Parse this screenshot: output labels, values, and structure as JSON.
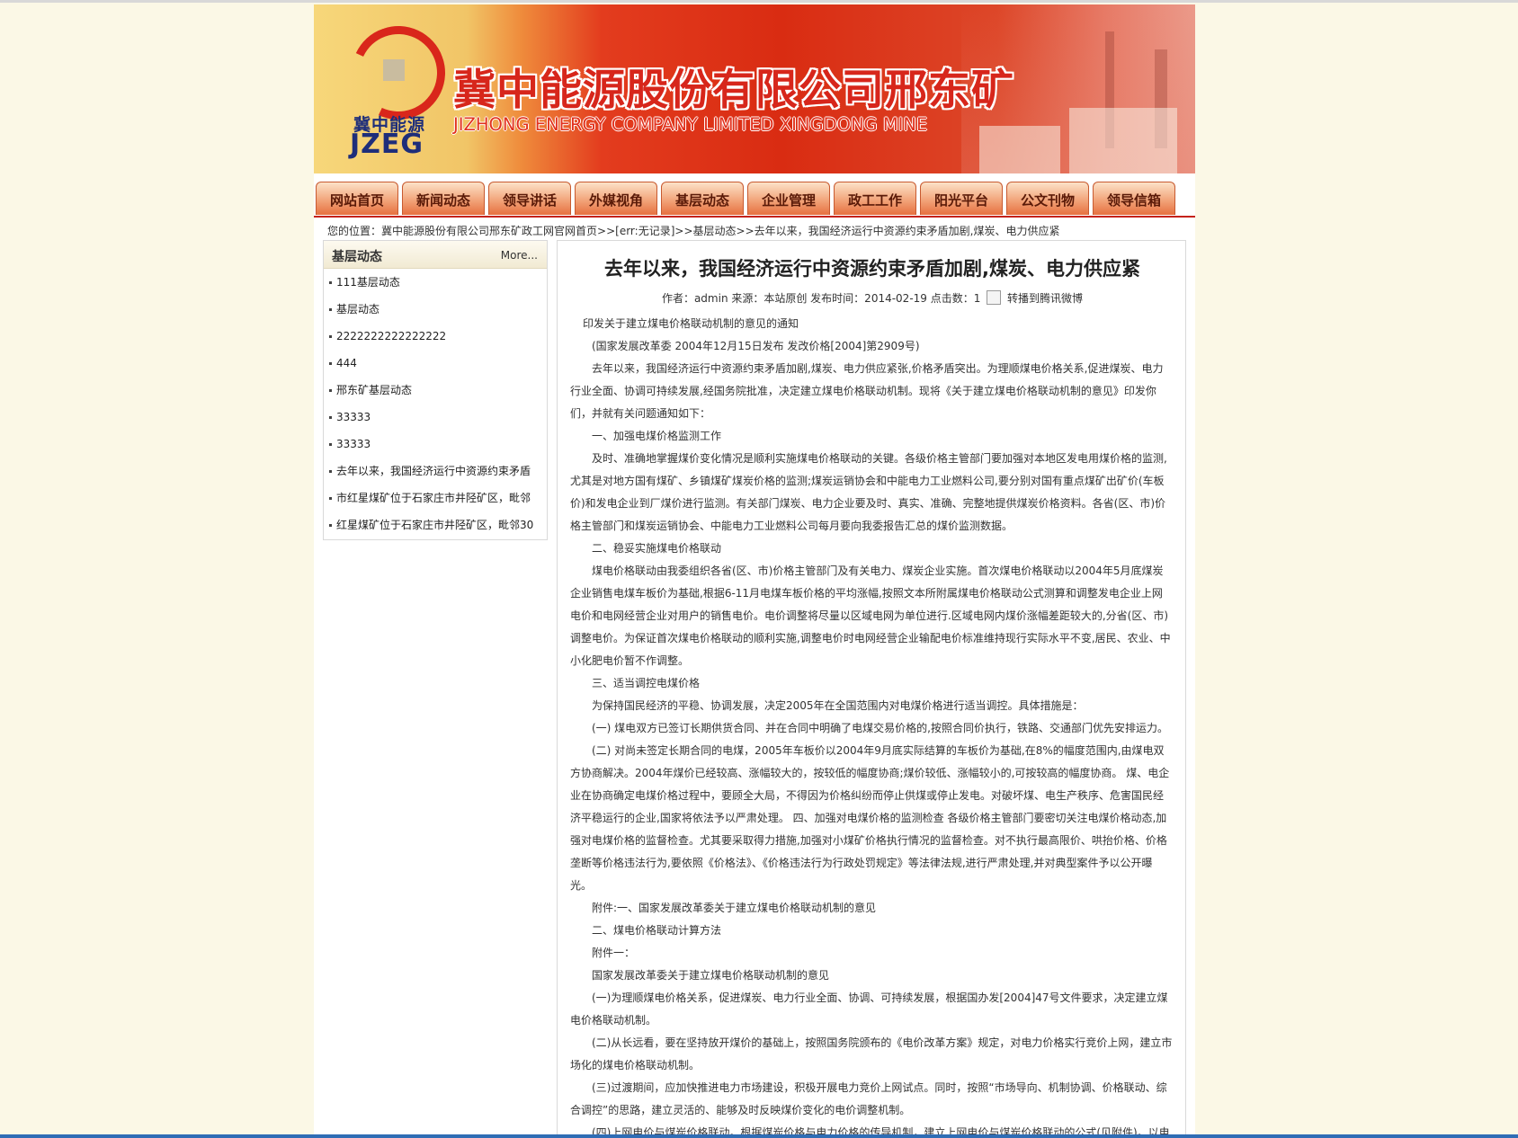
{
  "header": {
    "logo_cn": "冀中能源",
    "logo_en": "JZEG",
    "title_cn": "冀中能源股份有限公司邢东矿",
    "title_en": "JIZHONG ENERGY COMPANY LIMITED XINGDONG MINE"
  },
  "nav": {
    "items": [
      {
        "label": "网站首页"
      },
      {
        "label": "新闻动态"
      },
      {
        "label": "领导讲话"
      },
      {
        "label": "外媒视角"
      },
      {
        "label": "基层动态"
      },
      {
        "label": "企业管理"
      },
      {
        "label": "政工工作"
      },
      {
        "label": "阳光平台"
      },
      {
        "label": "公文刊物"
      },
      {
        "label": "领导信箱"
      }
    ]
  },
  "breadcrumb": {
    "prefix": "您的位置：",
    "home": "冀中能源股份有限公司邢东矿政工网官网首页",
    "sep1": ">>",
    "err": "[err:无记录]",
    "sep2": ">>",
    "category": "基层动态",
    "sep3": ">>",
    "current": "去年以来，我国经济运行中资源约束矛盾加剧,煤炭、电力供应紧"
  },
  "sidebar": {
    "title": "基层动态",
    "more": "More...",
    "items": [
      {
        "label": "111基层动态"
      },
      {
        "label": "基层动态"
      },
      {
        "label": "2222222222222222"
      },
      {
        "label": "444"
      },
      {
        "label": "邢东矿基层动态"
      },
      {
        "label": "33333"
      },
      {
        "label": "33333"
      },
      {
        "label": "去年以来，我国经济运行中资源约束矛盾"
      },
      {
        "label": "市红星煤矿位于石家庄市井陉矿区，毗邻"
      },
      {
        "label": "红星煤矿位于石家庄市井陉矿区，毗邻30"
      }
    ]
  },
  "article": {
    "title": "去年以来，我国经济运行中资源约束矛盾加剧,煤炭、电力供应紧",
    "meta_left": "作者：admin 来源：本站原创 发布时间：2014-02-19 点击数：1",
    "share": "转播到腾讯微博",
    "paragraphs": [
      {
        "text": "印发关于建立煤电价格联动机制的意见的通知",
        "cls": "note"
      },
      {
        "text": "(国家发展改革委 2004年12月15日发布 发改价格[2004]第2909号)"
      },
      {
        "text": "去年以来，我国经济运行中资源约束矛盾加剧,煤炭、电力供应紧张,价格矛盾突出。为理顺煤电价格关系,促进煤炭、电力行业全面、协调可持续发展,经国务院批准，决定建立煤电价格联动机制。现将《关于建立煤电价格联动机制的意见》印发你们，并就有关问题通知如下："
      },
      {
        "text": "一、加强电煤价格监测工作"
      },
      {
        "text": "及时、准确地掌握煤价变化情况是顺利实施煤电价格联动的关键。各级价格主管部门要加强对本地区发电用煤价格的监测,尤其是对地方国有煤矿、乡镇煤矿煤炭价格的监测;煤炭运销协会和中能电力工业燃料公司,要分别对国有重点煤矿出矿价(车板价)和发电企业到厂煤价进行监测。有关部门煤炭、电力企业要及时、真实、准确、完整地提供煤炭价格资料。各省(区、市)价格主管部门和煤炭运销协会、中能电力工业燃料公司每月要向我委报告汇总的煤价监测数据。"
      },
      {
        "text": "二、稳妥实施煤电价格联动"
      },
      {
        "text": "煤电价格联动由我委组织各省(区、市)价格主管部门及有关电力、煤炭企业实施。首次煤电价格联动以2004年5月底煤炭企业销售电煤车板价为基础,根据6-11月电煤车板价格的平均涨幅,按照文本所附属煤电价格联动公式测算和调整发电企业上网电价和电网经营企业对用户的销售电价。电价调整将尽量以区域电网为单位进行.区域电网内煤价涨幅差距较大的,分省(区、市)调整电价。为保证首次煤电价格联动的顺利实施,调整电价时电网经营企业输配电价标准维持现行实际水平不变,居民、农业、中小化肥电价暂不作调整。"
      },
      {
        "text": "三、适当调控电煤价格"
      },
      {
        "text": "为保持国民经济的平稳、协调发展，决定2005年在全国范围内对电煤价格进行适当调控。具体措施是："
      },
      {
        "text": "(一) 煤电双方已签订长期供货合同、并在合同中明确了电煤交易价格的,按照合同价执行，铁路、交通部门优先安排运力。"
      },
      {
        "text": "(二) 对尚未签定长期合同的电煤，2005年车板价以2004年9月底实际结算的车板价为基础,在8%的幅度范围内,由煤电双方协商解决。2004年煤价已经较高、涨幅较大的，按较低的幅度协商;煤价较低、涨幅较小的,可按较高的幅度协商。 煤、电企业在协商确定电煤价格过程中，要顾全大局，不得因为价格纠纷而停止供煤或停止发电。对破坏煤、电生产秩序、危害国民经济平稳运行的企业,国家将依法予以严肃处理。 四、加强对电煤价格的监测检查 各级价格主管部门要密切关注电煤价格动态,加强对电煤价格的监督检查。尤其要采取得力措施,加强对小煤矿价格执行情况的监督检查。对不执行最高限价、哄抬价格、价格垄断等价格违法行为,要依照《价格法》、《价格违法行为行政处罚规定》等法律法规,进行严肃处理,并对典型案件予以公开曝光。"
      },
      {
        "text": "附件:一、国家发展改革委关于建立煤电价格联动机制的意见"
      },
      {
        "text": "二、煤电价格联动计算方法"
      },
      {
        "text": "附件一："
      },
      {
        "text": "国家发展改革委关于建立煤电价格联动机制的意见"
      },
      {
        "text": "(一)为理顺煤电价格关系，促进煤炭、电力行业全面、协调、可持续发展，根据国办发[2004]47号文件要求，决定建立煤电价格联动机制。"
      },
      {
        "text": "(二)从长远看，要在坚持放开煤价的基础上，按照国务院颁布的《电价改革方案》规定，对电力价格实行竞价上网，建立市场化的煤电价格联动机制。"
      },
      {
        "text": "(三)过渡期间，应加快推进电力市场建设，积极开展电力竞价上网试点。同时，按照“市场导向、机制协调、价格联动、综合调控”的思路，建立灵活的、能够及时反映煤价变化的电价调整机制。"
      },
      {
        "text": "(四)上网电价与煤炭价格联动。根据煤炭价格与电力价格的传导机制，建立上网电价与煤炭价格联动的公式(见附件)。以电"
      }
    ]
  }
}
